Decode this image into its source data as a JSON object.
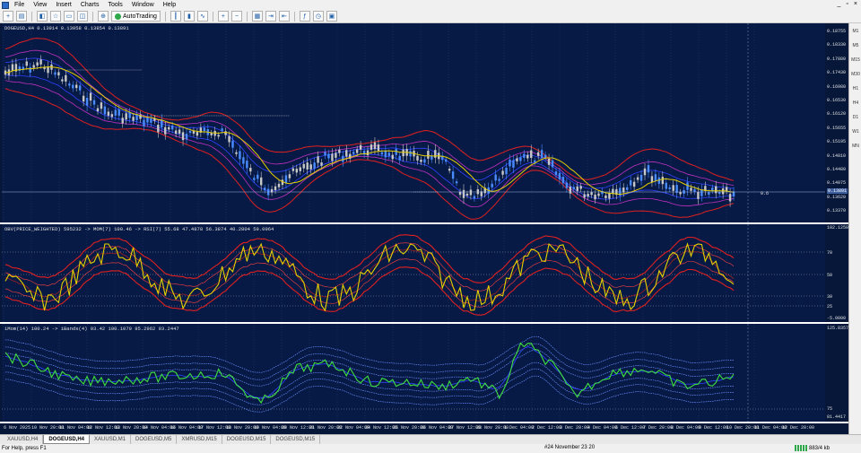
{
  "menu": [
    "File",
    "View",
    "Insert",
    "Charts",
    "Tools",
    "Window",
    "Help"
  ],
  "toolbar": {
    "autotrading_label": "AutoTrading"
  },
  "pane1": {
    "label": "DOGEUSD,H4  0.13914 0.13958 0.13854 0.13891",
    "price_ticks": [
      "0.18755",
      "0.18330",
      "0.17880",
      "0.17430",
      "0.16980",
      "0.16530",
      "0.16120",
      "0.15655",
      "0.15195",
      "0.14810",
      "0.14480",
      "0.14075",
      "0.13620",
      "0.13370"
    ],
    "current_price": "0.13891",
    "crosshair_value": "0.6"
  },
  "pane2": {
    "label": "OBV(PRICE_WEIGHTED) 595232 -> MOM(7) 100.46 -> RSI(7) 55.68  47.4878 56.3874 40.2804 59.0964",
    "scale_top": "102.1250",
    "scale_bottom": "-5.0000",
    "levels": [
      "70",
      "50",
      "30",
      "25"
    ]
  },
  "pane3": {
    "label": "iMom(14) 100.24 -> iBands(4) 93.42  100.1070 95.2962 93.2447",
    "scale_top": "125.8357",
    "scale_bottom": "81.4417",
    "levels": [
      "75"
    ]
  },
  "time_axis": [
    "6 Nov 2025",
    "10 Nov 20:00",
    "11 Nov 04:00",
    "12 Nov 12:00",
    "13 Nov 20:00",
    "14 Nov 04:00",
    "16 Nov 04:00",
    "17 Nov 12:00",
    "18 Nov 20:00",
    "19 Nov 04:00",
    "20 Nov 12:00",
    "21 Nov 20:00",
    "22 Nov 04:00",
    "24 Nov 12:00",
    "25 Nov 20:00",
    "26 Nov 04:00",
    "27 Nov 12:00",
    "28 Nov 20:00",
    "1 Dec 04:00",
    "2 Dec 12:00",
    "3 Dec 20:00",
    "4 Dec 04:00",
    "6 Dec 12:00",
    "7 Dec 20:00",
    "8 Dec 04:00",
    "9 Dec 12:00",
    "10 Dec 20:00",
    "11 Dec 04:00",
    "12 Dec 20:00"
  ],
  "timeframes": [
    "M1",
    "M5",
    "M15",
    "M30",
    "H1",
    "H4",
    "D1",
    "W1",
    "MN"
  ],
  "tabs": [
    "XAUUSD,H4",
    "DOGEUSD,H4",
    "XAUUSD,M1",
    "DOGEUSD,M5",
    "XMRUSD,M15",
    "DOGEUSD,M15",
    "DOGEUSD,M15"
  ],
  "active_tab_index": 1,
  "status": {
    "help": "For Help, press F1",
    "bar_info": "#24 November 23 20",
    "connection": "883/4 kb"
  },
  "colors": {
    "background": "#071a45",
    "bull_candle": "#4a8cff",
    "bear_candle": "#c8c8c8",
    "ma_yellow": "#e6d000",
    "band_red": "#e02020",
    "band_magenta": "#c030c0",
    "band_blue": "#3040ff",
    "line_green": "#40e040",
    "band_dotted": "#6a8cff"
  }
}
